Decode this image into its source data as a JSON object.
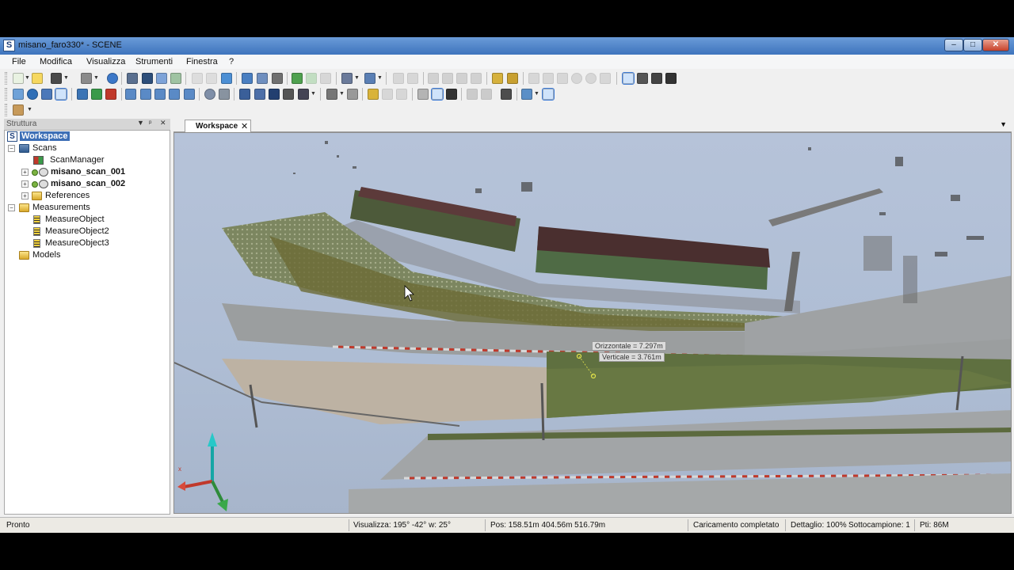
{
  "window": {
    "app_icon": "S",
    "title": "misano_faro330* - SCENE",
    "minimize_icon": "minimize-icon",
    "maximize_icon": "maximize-icon",
    "close_icon": "close-icon"
  },
  "menu": [
    "File",
    "Modifica",
    "Visualizza",
    "Strumenti",
    "Finestra",
    "?"
  ],
  "panel": {
    "title": "Struttura",
    "tree": [
      {
        "label": "Workspace",
        "icon": "scene-logo-icon",
        "selected": true
      },
      {
        "label": "Scans",
        "icon": "scans-folder-icon"
      },
      {
        "label": "ScanManager",
        "icon": "scan-manager-icon"
      },
      {
        "label": "misano_scan_001",
        "icon": "scan-icon",
        "bold": true
      },
      {
        "label": "misano_scan_002",
        "icon": "scan-icon",
        "bold": true
      },
      {
        "label": "References",
        "icon": "folder-icon"
      },
      {
        "label": "Measurements",
        "icon": "folder-icon"
      },
      {
        "label": "MeasureObject",
        "icon": "measure-icon"
      },
      {
        "label": "MeasureObject2",
        "icon": "measure-icon"
      },
      {
        "label": "MeasureObject3",
        "icon": "measure-icon"
      },
      {
        "label": "Models",
        "icon": "folder-icon"
      }
    ]
  },
  "workspace": {
    "tab_label": "Workspace",
    "measurement": {
      "horizontal": "Orizzontale = 7.297m",
      "vertical": "Verticale = 3.761m"
    },
    "axis_label_x": "x"
  },
  "status": {
    "ready": "Pronto",
    "view": "Visualizza: 195° -42° w: 25°",
    "pos": "Pos: 158.51m 404.56m 516.79m",
    "loading": "Caricamento completato",
    "detail": "Dettaglio: 100%",
    "subsample": "Sottocampione:  1",
    "points": "Pti: 86M"
  }
}
